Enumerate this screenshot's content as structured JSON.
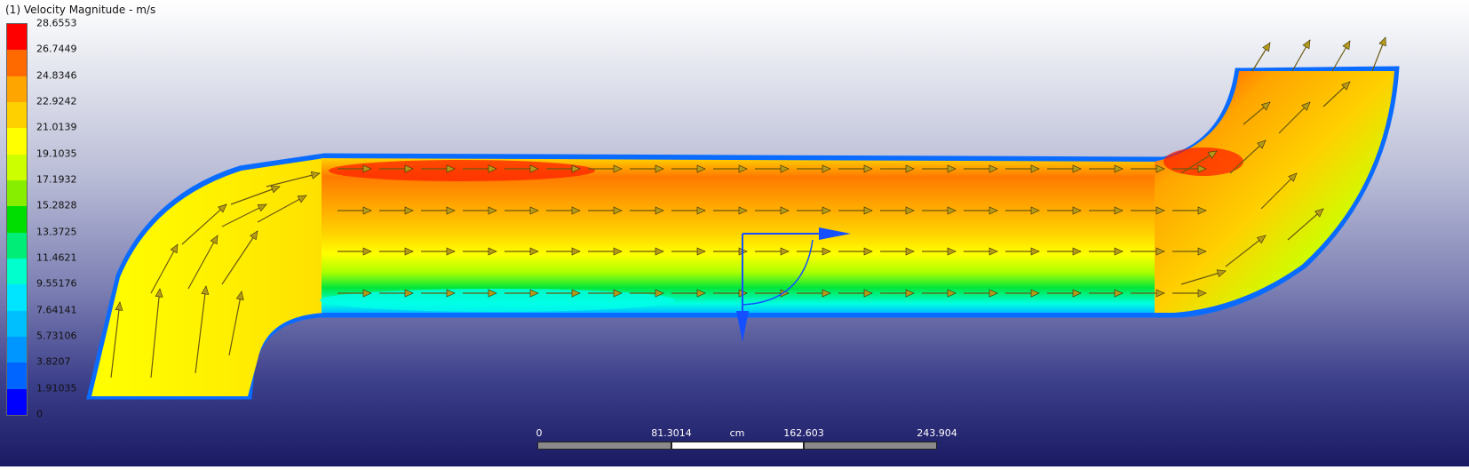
{
  "legend": {
    "title": "(1) Velocity Magnitude - m/s",
    "labels": [
      "28.6553",
      "26.7449",
      "24.8346",
      "22.9242",
      "21.0139",
      "19.1035",
      "17.1932",
      "15.2828",
      "13.3725",
      "11.4621",
      "9.55176",
      "7.64141",
      "5.73106",
      "3.8207",
      "1.91035",
      "0"
    ],
    "colors": [
      "#ff0000",
      "#ff6a00",
      "#ffa500",
      "#ffd000",
      "#ffff00",
      "#ccff00",
      "#88ee00",
      "#00dd00",
      "#00ee77",
      "#00ffcc",
      "#00e5ff",
      "#00bfff",
      "#0096ff",
      "#0064ff",
      "#0000ff"
    ]
  },
  "scalebar": {
    "ticks": [
      "0",
      "81.3014",
      "162.603",
      "243.904"
    ],
    "unit": "cm"
  },
  "view": {
    "pipe_outline_color": "#0a6cff",
    "background_top": "#ffffff",
    "background_bottom": "#1a1a63",
    "triad_color": "#1450ff",
    "arrow_color": "#6b5a10"
  }
}
